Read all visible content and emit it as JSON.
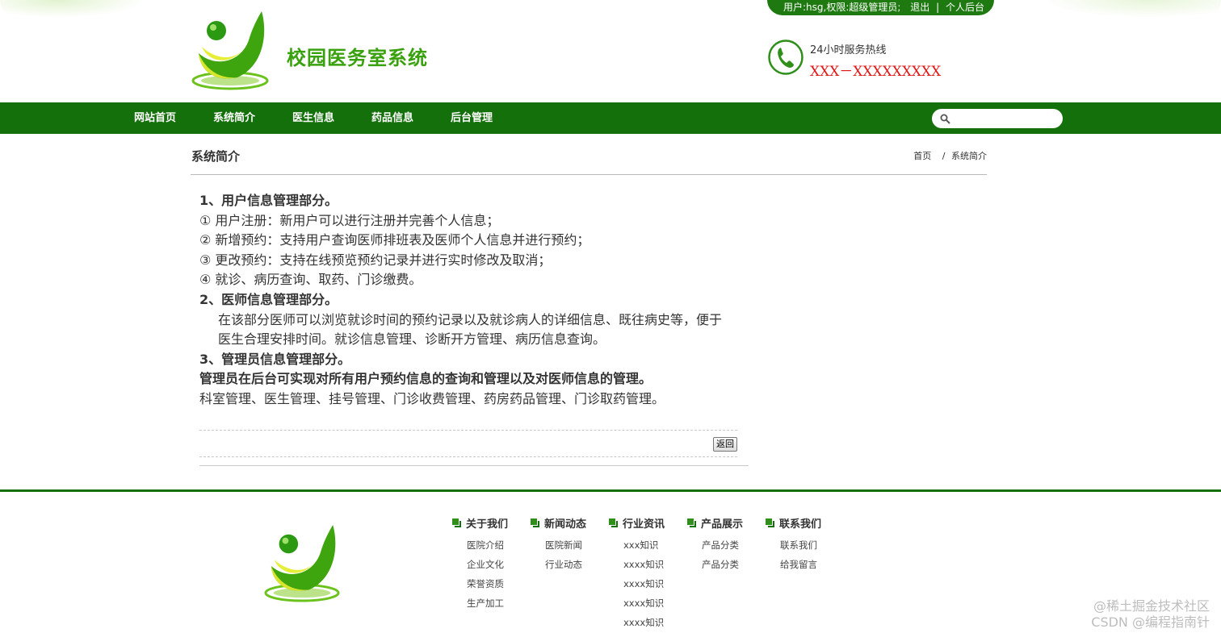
{
  "header": {
    "user_info": "用户:hsg,权限:超级管理员;",
    "logout": "退出",
    "separator": "|",
    "admin_link": "个人后台",
    "site_title": "校园医务室系统",
    "hotline_label": "24小时服务热线",
    "hotline_number": "XXX－XXXXXXXXX"
  },
  "nav": {
    "items": [
      {
        "label": "网站首页"
      },
      {
        "label": "系统简介"
      },
      {
        "label": "医生信息"
      },
      {
        "label": "药品信息"
      },
      {
        "label": "后台管理"
      }
    ],
    "search_value": ""
  },
  "page": {
    "section_title": "系统简介",
    "breadcrumb_home": "首页",
    "breadcrumb_sep": "/",
    "breadcrumb_current": "系统简介"
  },
  "article": {
    "h1": "1、用户信息管理部分。",
    "item1": "① 用户注册：新用户可以进行注册并完善个人信息；",
    "item2": "② 新增预约：支持用户查询医师排班表及医师个人信息并进行预约；",
    "item3": "③ 更改预约：支持在线预览预约记录并进行实时修改及取消；",
    "item4": "④ 就诊、病历查询、取药、门诊缴费。",
    "h2": "2、医师信息管理部分。",
    "p2": "在该部分医师可以浏览就诊时间的预约记录以及就诊病人的详细信息、既往病史等，便于医生合理安排时间。就诊信息管理、诊断开方管理、病历信息查询。",
    "h3": "3、管理员信息管理部分。",
    "p3_bold": "管理员在后台可实现对所有用户预约信息的查询和管理以及对医师信息的管理。",
    "p3": "科室管理、医生管理、挂号管理、门诊收费管理、药房药品管理、门诊取药管理。"
  },
  "actions": {
    "back_label": "返回"
  },
  "footer": {
    "columns": [
      {
        "title": "关于我们",
        "links": [
          "医院介绍",
          "企业文化",
          "荣誉资质",
          "生产加工"
        ]
      },
      {
        "title": "新闻动态",
        "links": [
          "医院新闻",
          "行业动态"
        ]
      },
      {
        "title": "行业资讯",
        "links": [
          "xxx知识",
          "xxxx知识",
          "xxxx知识",
          "xxxx知识",
          "xxxx知识"
        ]
      },
      {
        "title": "产品展示",
        "links": [
          "产品分类",
          "产品分类"
        ]
      },
      {
        "title": "联系我们",
        "links": [
          "联系我们",
          "给我留言"
        ]
      }
    ],
    "watermark_line1": "@稀土掘金技术社区",
    "watermark_line2": "CSDN @编程指南针"
  },
  "colors": {
    "nav_green": "#14700a",
    "title_green": "#3aa10e",
    "hotline_red": "#e01818"
  }
}
